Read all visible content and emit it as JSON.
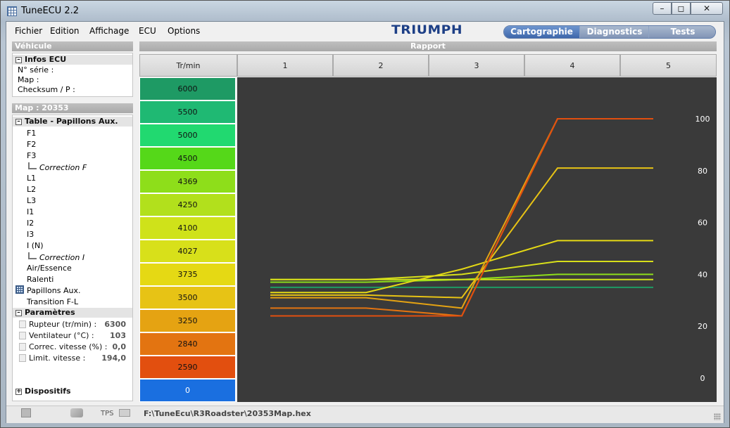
{
  "window": {
    "title": "TuneECU 2.2"
  },
  "menubar": {
    "items": [
      "Fichier",
      "Edition",
      "Affichage",
      "ECU",
      "Options"
    ]
  },
  "brand": {
    "logo_text": "TRIUMPH"
  },
  "tabs": [
    {
      "label": "Cartographie",
      "active": true
    },
    {
      "label": "Diagnostics",
      "active": false
    },
    {
      "label": "Tests",
      "active": false
    }
  ],
  "sidebar": {
    "vehicule_header": "Véhicule",
    "infos_ecu": {
      "title": "Infos ECU",
      "lines": [
        "N° série :",
        "Map :",
        "Checksum / P :"
      ]
    },
    "map_header": "Map : 20353",
    "table_group": {
      "title": "Table - Papillons Aux.",
      "items": [
        "F1",
        "F2",
        "F3",
        "Correction F",
        "L1",
        "L2",
        "L3",
        "I1",
        "I2",
        "I3",
        "I (N)",
        "Correction I",
        "Air/Essence",
        "Ralenti",
        "Papillons Aux.",
        "Transition F-L"
      ]
    },
    "parametres": {
      "title": "Paramètres",
      "rows": [
        {
          "label": "Rupteur (tr/min) :",
          "value": "6300"
        },
        {
          "label": "Ventilateur (°C) :",
          "value": "103"
        },
        {
          "label": "Correc. vitesse (%) :",
          "value": "0,0"
        },
        {
          "label": "Limit. vitesse :",
          "value": "194,0"
        }
      ]
    },
    "dispositifs": {
      "title": "Dispositifs"
    }
  },
  "map_view": {
    "rapport_header": "Rapport",
    "corner_label": "Tr/min",
    "gears": [
      "1",
      "2",
      "3",
      "4",
      "5"
    ],
    "rpm_rows": [
      {
        "rpm": "6000",
        "color": "#1e9a64"
      },
      {
        "rpm": "5500",
        "color": "#1fb973"
      },
      {
        "rpm": "5000",
        "color": "#21d970"
      },
      {
        "rpm": "4500",
        "color": "#55d819"
      },
      {
        "rpm": "4369",
        "color": "#8ede1a"
      },
      {
        "rpm": "4250",
        "color": "#b2e01c"
      },
      {
        "rpm": "4100",
        "color": "#cfe21a"
      },
      {
        "rpm": "4027",
        "color": "#d8e01a"
      },
      {
        "rpm": "3735",
        "color": "#e5d914"
      },
      {
        "rpm": "3500",
        "color": "#e7c315"
      },
      {
        "rpm": "3250",
        "color": "#e5a312"
      },
      {
        "rpm": "2840",
        "color": "#e37411"
      },
      {
        "rpm": "2590",
        "color": "#e24f0f"
      },
      {
        "rpm": "0",
        "color": "#1a6fe0"
      }
    ]
  },
  "chart_data": {
    "type": "line",
    "x": [
      1,
      2,
      3,
      4,
      5
    ],
    "xlabel": "Rapport",
    "ylim": [
      0,
      100
    ],
    "yticks": [
      "100",
      "80",
      "60",
      "40",
      "20",
      "0"
    ],
    "series": [
      {
        "name": "6000",
        "color": "#1e9a64",
        "values": [
          35,
          35,
          35,
          35,
          35
        ]
      },
      {
        "name": "4369",
        "color": "#8ede1a",
        "values": [
          37,
          37,
          38,
          40,
          40
        ]
      },
      {
        "name": "4100",
        "color": "#cfe21a",
        "values": [
          38,
          38,
          38,
          38,
          38
        ]
      },
      {
        "name": "4027",
        "color": "#d8e01a",
        "values": [
          38,
          38,
          40,
          45,
          45
        ]
      },
      {
        "name": "3735",
        "color": "#e5d914",
        "values": [
          33,
          33,
          42,
          53,
          53
        ]
      },
      {
        "name": "3500",
        "color": "#e7c315",
        "values": [
          32,
          32,
          31,
          81,
          81
        ]
      },
      {
        "name": "3250",
        "color": "#e5a312",
        "values": [
          31,
          31,
          27,
          100,
          100
        ]
      },
      {
        "name": "2840",
        "color": "#e37411",
        "values": [
          27,
          27,
          24,
          100,
          100
        ]
      },
      {
        "name": "2590",
        "color": "#e24f0f",
        "values": [
          24,
          24,
          24,
          100,
          100
        ]
      }
    ]
  },
  "statusbar": {
    "tps_label": "TPS",
    "file_path": "F:\\TuneEcu\\R3Roadster\\20353Map.hex"
  }
}
